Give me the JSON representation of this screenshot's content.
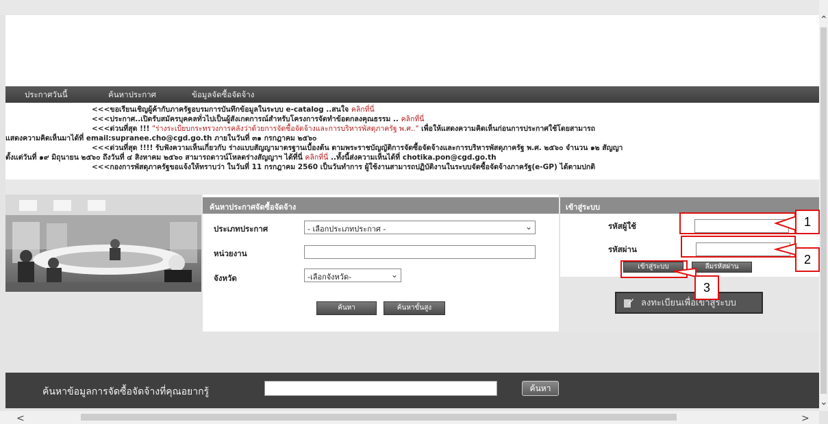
{
  "nav": {
    "items": [
      "ประกาศวันนี้",
      "ค้นหาประกาศ",
      "ข้อมูลจัดซื้อจัดจ้าง"
    ]
  },
  "news": {
    "line1_text": "<<<ขอเรียนเชิญผู้ค้ากับภาครัฐอบรมการบันทึกข้อมูลในระบบ e-catalog ..สนใจ",
    "line1_link": "คลิกที่นี่",
    "line2_text": "<<<ประกาศ..เปิดรับสมัครบุคคลทั่วไปเป็นผู้สังเกตการณ์สำหรับโครงการจัดทำข้อตกลงคุณธรรม ..",
    "line2_link": "คลิกที่นี่",
    "line3_text": "<<<ด่วนที่สุด !!! ",
    "line3_red": "\"ร่างระเบียบกระทรวงการคลังว่าด้วยการจัดซื้อจัดจ้างและการบริหารพัสดุภาครัฐ พ.ศ..\"",
    "line3_rest": " เพื่อให้แสดงความคิดเห็นก่อนการประกาศใช้โดยสามารถ",
    "line4_text": "แสดงความคิดเห็นมาได้ที่ email:supranee.cho@cgd.go.th ภายในวันที่ ๓๑ กรกฎาคม ๒๕๖๐",
    "line5_text": "<<<ด่วนที่สุด !!!! รับฟังความเห็นเกี่ยวกับ ร่างแบบสัญญามาตรฐานเบื้องต้น ตามพระราชบัญญัติการจัดซื้อจัดจ้างและการบริหารพัสดุภาครัฐ พ.ศ. ๒๕๖๐ จำนวน ๑๒ สัญญา",
    "line6_text": "ตั้งแต่วันที่ ๑๙ มิถุนายน ๒๕๖๐ ถึงวันที่ ๔ สิงหาคม ๒๕๖๐ สามารถดาวน์โหลดร่างสัญญาฯ ได้ที่นี่",
    "line6_link": "คลิกที่นี่",
    "line6_rest": "..ทั้งนี้ส่งความเห็นได้ที่ chotika.pon@cgd.go.th",
    "line7_text": "<<<กองการพัสดุภาครัฐขอแจ้งให้ทราบว่า ในวันที่ 11 กรกฎาคม 2560 เป็นวันทำการ ผู้ใช้งานสามารถปฏิบัติงานในระบบจัดซื้อจัดจ้างภาครัฐ(e-GP) ได้ตามปกติ"
  },
  "search": {
    "title": "ค้นหาประกาศจัดซื้อจัดจ้าง",
    "type_label": "ประเภทประกาศ",
    "type_value": "- เลือกประเภทประกาศ -",
    "agency_label": "หน่วยงาน",
    "agency_value": "",
    "province_label": "จังหวัด",
    "province_value": "-เลือกจังหวัด-",
    "search_button": "ค้นหา",
    "advanced_button": "ค้นหาขั้นสูง"
  },
  "login": {
    "title": "เข้าสู่ระบบ",
    "username_label": "รหัสผู้ใช้",
    "username_value": "",
    "password_label": "รหัสผ่าน",
    "password_value": "",
    "login_button": "เข้าสู่ระบบ",
    "forgot_button": "ลืมรหัสผ่าน",
    "register_button": "ลงทะเบียนเพื่อเข้าสู่ระบบ"
  },
  "footer_search": {
    "label": "ค้นหาข้อมูลการจัดซื้อจัดจ้างที่คุณอยากรู้",
    "value": "",
    "button": "ค้นหา"
  },
  "callouts": [
    "1",
    "2",
    "3"
  ],
  "colors": {
    "nav_bg": "#4a4a4a",
    "panel_head": "#8c8c8c",
    "news_red": "#b01818",
    "callout_red": "#e01010"
  }
}
